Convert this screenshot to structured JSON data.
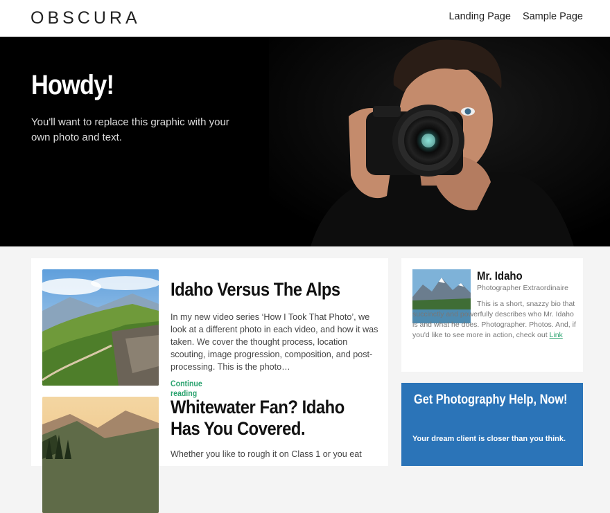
{
  "header": {
    "logo": "OBSCURA",
    "nav": [
      "Landing Page",
      "Sample Page"
    ]
  },
  "hero": {
    "title": "Howdy!",
    "subtitle": "You'll want to replace this graphic with your own photo and text."
  },
  "posts": [
    {
      "title": "Idaho Versus The Alps",
      "excerpt": "In my new video series ‘How I Took That Photo’, we look at a different photo in each video, and how it was taken. We cover the thought process, location scouting, image progression, composition, and post-processing. This is the photo…",
      "more": "Continue reading"
    },
    {
      "title_line1": "Whitewater Fan? Idaho",
      "title_line2": "Has You Covered.",
      "excerpt": "Whether you like to rough it on Class 1 or you eat"
    }
  ],
  "bio": {
    "name": "Mr. Idaho",
    "role": "Photographer Extraordinaire",
    "text": "This is a short, snazzy bio that succinctly and powerfully describes who Mr. Idaho is and what he does. Photographer. Photos. And, if you'd like to see more in action, check out",
    "link": "Link"
  },
  "cta": {
    "title": "Get Photography Help, Now!",
    "text": "Your dream client is closer than you think."
  }
}
